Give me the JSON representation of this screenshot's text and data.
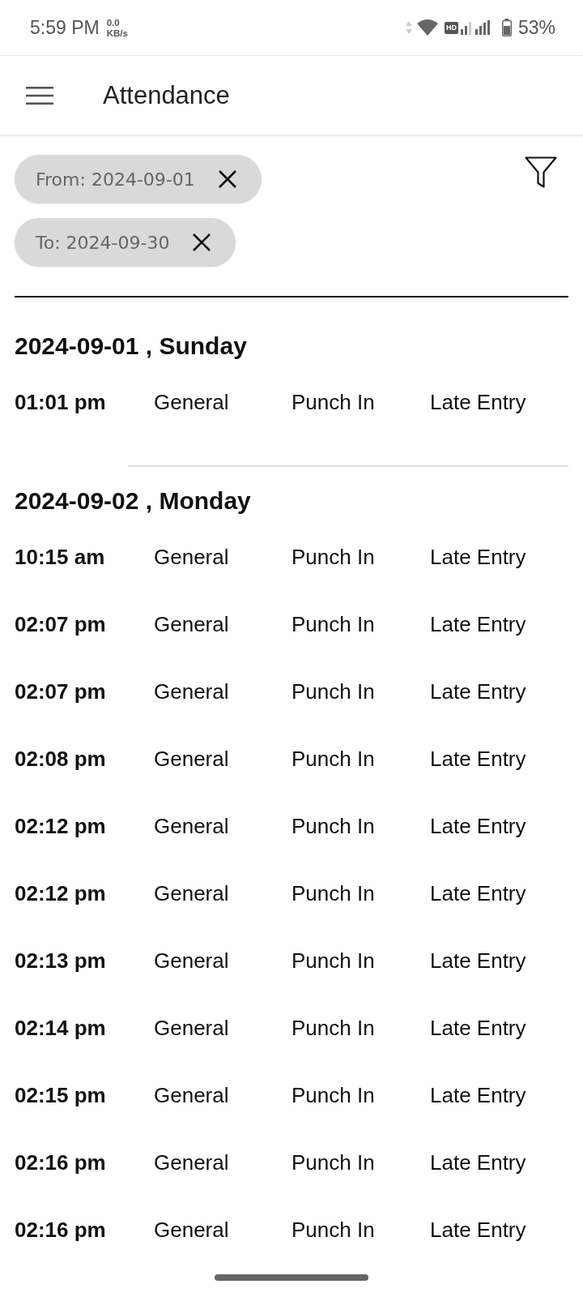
{
  "status_bar": {
    "time": "5:59 PM",
    "net_speed_value": "0.0",
    "net_speed_unit": "KB/s",
    "network_badge": "HD",
    "battery": "53%"
  },
  "app_bar": {
    "title": "Attendance"
  },
  "filters": [
    {
      "label": "From: 2024-09-01"
    },
    {
      "label": "To: 2024-09-30"
    }
  ],
  "days": [
    {
      "date": "2024-09-01 , Sunday",
      "entries": [
        {
          "time": "01:01 pm",
          "shift": "General",
          "type": "Punch In",
          "status": "Late Entry"
        }
      ]
    },
    {
      "date": "2024-09-02 , Monday",
      "entries": [
        {
          "time": "10:15 am",
          "shift": "General",
          "type": "Punch In",
          "status": "Late Entry"
        },
        {
          "time": "02:07 pm",
          "shift": "General",
          "type": "Punch In",
          "status": "Late Entry"
        },
        {
          "time": "02:07 pm",
          "shift": "General",
          "type": "Punch In",
          "status": "Late Entry"
        },
        {
          "time": "02:08 pm",
          "shift": "General",
          "type": "Punch In",
          "status": "Late Entry"
        },
        {
          "time": "02:12 pm",
          "shift": "General",
          "type": "Punch In",
          "status": "Late Entry"
        },
        {
          "time": "02:12 pm",
          "shift": "General",
          "type": "Punch In",
          "status": "Late Entry"
        },
        {
          "time": "02:13 pm",
          "shift": "General",
          "type": "Punch In",
          "status": "Late Entry"
        },
        {
          "time": "02:14 pm",
          "shift": "General",
          "type": "Punch In",
          "status": "Late Entry"
        },
        {
          "time": "02:15 pm",
          "shift": "General",
          "type": "Punch In",
          "status": "Late Entry"
        },
        {
          "time": "02:16 pm",
          "shift": "General",
          "type": "Punch In",
          "status": "Late Entry"
        },
        {
          "time": "02:16 pm",
          "shift": "General",
          "type": "Punch In",
          "status": "Late Entry"
        }
      ]
    }
  ]
}
